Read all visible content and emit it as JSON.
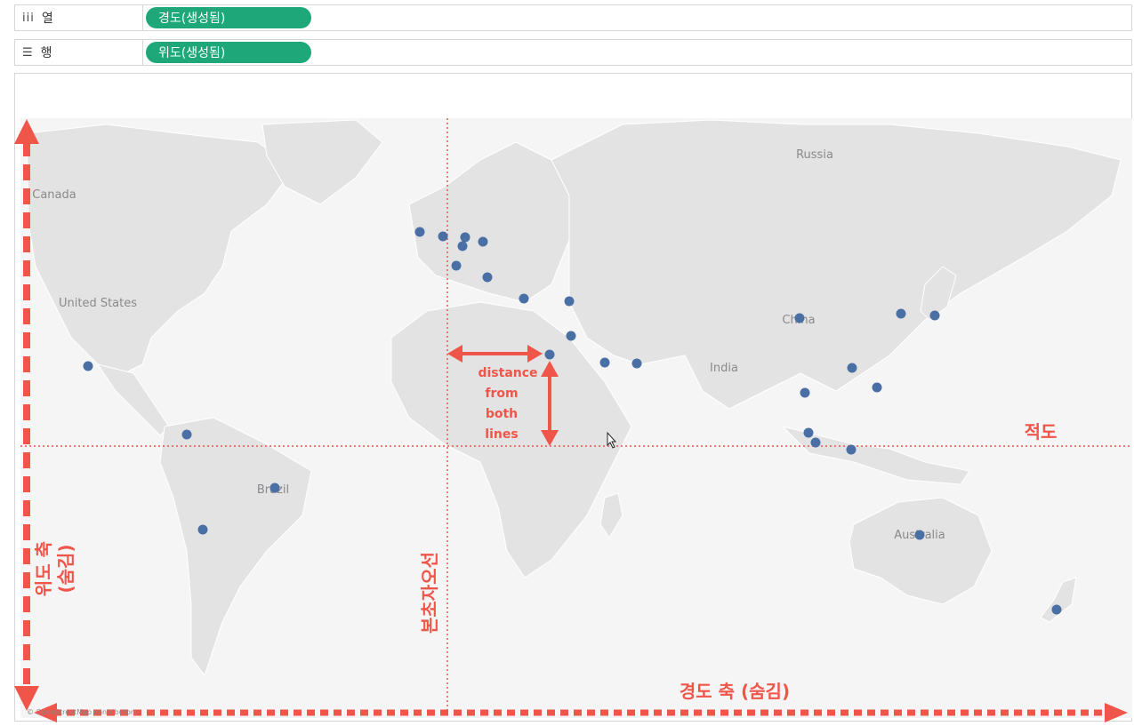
{
  "shelves": {
    "columns": {
      "icon": "columns-icon",
      "label": "열",
      "pill": "경도(생성됨)"
    },
    "rows": {
      "icon": "rows-icon",
      "label": "행",
      "pill": "위도(생성됨)"
    }
  },
  "map": {
    "country_labels": [
      "Russia",
      "Canada",
      "United States",
      "China",
      "India",
      "Brazil",
      "Australia"
    ],
    "credit": "© OpenStreetMap contributors"
  },
  "annotations": {
    "lat_axis": "위도 축",
    "lat_axis_hidden": "(숨김)",
    "lon_axis": "경도 축 (숨김)",
    "prime_meridian": "본초자오선",
    "equator": "적도",
    "distance_lines": [
      "distance",
      "from",
      "both",
      "lines"
    ]
  },
  "colors": {
    "pill": "#1ea87a",
    "point": "#4a6fa5",
    "annotation": "#f0554a",
    "land": "#e6e6e6"
  }
}
